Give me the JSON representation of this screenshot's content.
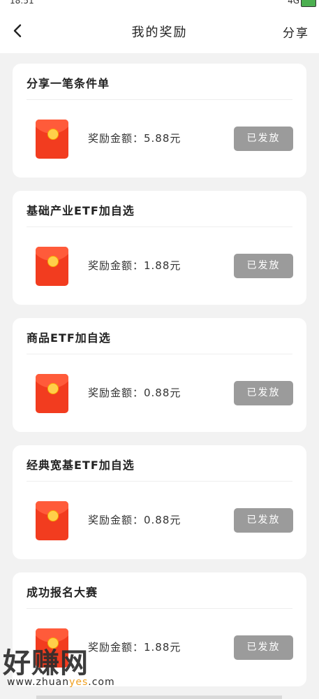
{
  "status_bar": {
    "time": "18:51",
    "network": "4G"
  },
  "header": {
    "title": "我的奖励",
    "share_label": "分享"
  },
  "rewards": [
    {
      "title": "分享一笔条件单",
      "amount_label": "奖励金额：5.88元",
      "status_label": "已发放"
    },
    {
      "title": "基础产业ETF加自选",
      "amount_label": "奖励金额：1.88元",
      "status_label": "已发放"
    },
    {
      "title": "商品ETF加自选",
      "amount_label": "奖励金额：0.88元",
      "status_label": "已发放"
    },
    {
      "title": "经典宽基ETF加自选",
      "amount_label": "奖励金额：0.88元",
      "status_label": "已发放"
    },
    {
      "title": "成功报名大赛",
      "amount_label": "奖励金额：1.88元",
      "status_label": "已发放"
    }
  ],
  "watermark": {
    "brand": "好赚网",
    "url_prefix": "www.zhuan",
    "url_accent": "yes",
    "url_suffix": ".com"
  },
  "colors": {
    "envelope": "#f23c1f",
    "button_disabled": "#9b9b9b",
    "background": "#f2f2f2"
  }
}
